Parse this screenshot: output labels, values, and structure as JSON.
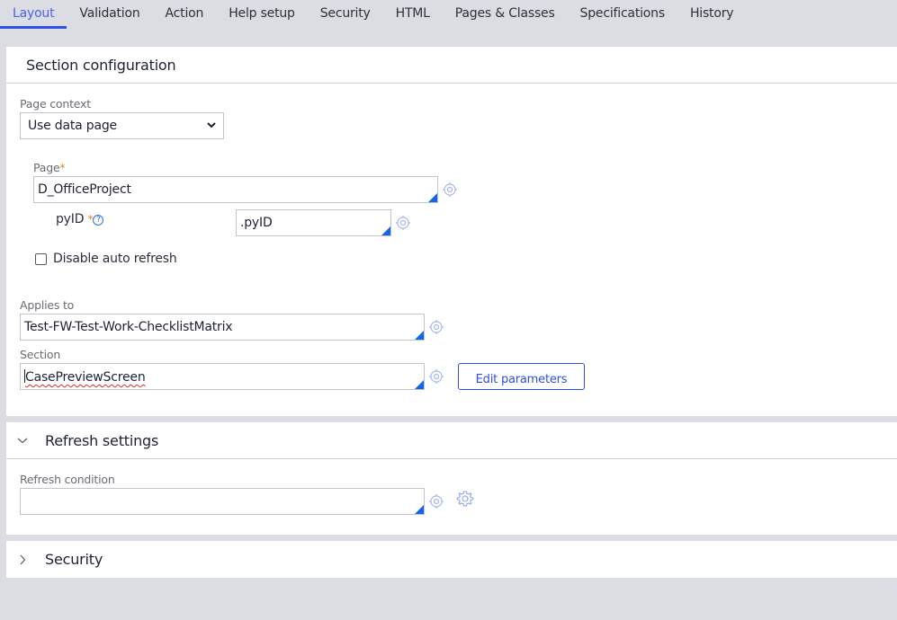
{
  "tabs": [
    {
      "label": "Layout",
      "active": true
    },
    {
      "label": "Validation",
      "active": false
    },
    {
      "label": "Action",
      "active": false
    },
    {
      "label": "Help setup",
      "active": false
    },
    {
      "label": "Security",
      "active": false
    },
    {
      "label": "HTML",
      "active": false
    },
    {
      "label": "Pages & Classes",
      "active": false
    },
    {
      "label": "Specifications",
      "active": false
    },
    {
      "label": "History",
      "active": false
    }
  ],
  "section_configuration": {
    "title": "Section configuration",
    "page_context": {
      "label": "Page context",
      "value": "Use data page",
      "icon": "chevron-down-icon"
    },
    "page": {
      "label": "Page",
      "required_marker": "*",
      "value": "D_OfficeProject",
      "icon": "target-icon"
    },
    "param_pyid": {
      "label": "pyID",
      "required_marker": "*",
      "help_icon": "?",
      "value": ".pyID",
      "icon": "target-icon"
    },
    "disable_auto_refresh": {
      "label": "Disable auto refresh",
      "checked": false
    },
    "applies_to": {
      "label": "Applies to",
      "value": "Test-FW-Test-Work-ChecklistMatrix",
      "icon": "target-icon"
    },
    "section": {
      "label": "Section",
      "value": "CasePreviewScreen",
      "icon": "target-icon"
    },
    "edit_parameters_label": "Edit parameters"
  },
  "refresh_settings": {
    "title": "Refresh settings",
    "expanded": true,
    "refresh_condition": {
      "label": "Refresh condition",
      "value": "",
      "icons": [
        "target-icon",
        "gear-icon"
      ]
    }
  },
  "security": {
    "title": "Security",
    "expanded": false
  },
  "colors": {
    "accent": "#2f4fe6",
    "required": "#e08a1e",
    "corner": "#1366e8",
    "background": "#dcdde2"
  }
}
